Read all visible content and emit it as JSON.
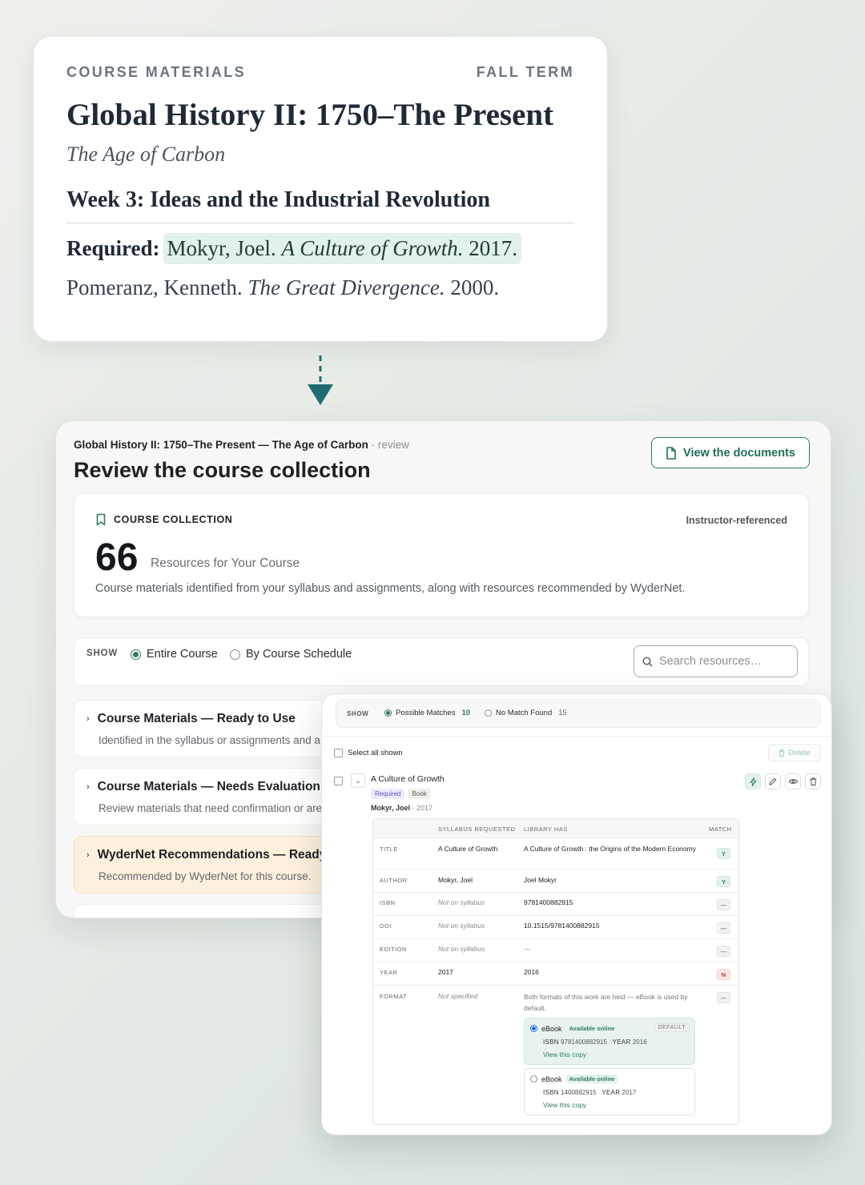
{
  "syllabus": {
    "kicker_left": "COURSE MATERIALS",
    "kicker_right": "FALL TERM",
    "title": "Global History II: 1750–The Present",
    "subtitle": "The Age of Carbon",
    "week": "Week 3: Ideas and the Industrial Revolution",
    "required_label": "Required:",
    "required_author": "Mokyr, Joel.",
    "required_work": "A Culture of Growth.",
    "required_year": "2017.",
    "second_author": "Pomeranz, Kenneth.",
    "second_work": "The Great Divergence.",
    "second_year": "2000."
  },
  "review": {
    "breadcrumb": "Global History II: 1750–The Present — The Age of Carbon",
    "breadcrumb_suffix": " · review",
    "title": "Review the course collection",
    "view_docs_label": "View the documents",
    "collection": {
      "label": "COURSE COLLECTION",
      "right_label": "Instructor-referenced",
      "count": "66",
      "count_label": "Resources for Your Course",
      "description": "Course materials identified from your syllabus and assignments, along with resources recommended by WyderNet."
    },
    "show": {
      "label": "SHOW",
      "option1": "Entire Course",
      "option2": "By Course Schedule",
      "search_placeholder": "Search resources…"
    },
    "sections": [
      {
        "title": "Course Materials — Ready to Use",
        "desc": "Identified in the syllabus or assignments and a"
      },
      {
        "title": "Course Materials — Needs Evaluation",
        "desc": "Review materials that need confirmation or are"
      },
      {
        "title": "WyderNet Recommendations — Ready",
        "desc": "Recommended by WyderNet for this course."
      }
    ]
  },
  "matches": {
    "show_label": "SHOW",
    "opt_possible": "Possible Matches",
    "opt_possible_count": "10",
    "opt_nomatch": "No Match Found",
    "opt_nomatch_count": "15",
    "select_all": "Select all shown",
    "delete_label": "Delete",
    "item": {
      "title": "A Culture of Growth",
      "tag_required": "Required",
      "tag_book": "Book",
      "author": "Mokyr, Joel",
      "year": " · 2017"
    },
    "table": {
      "headers": [
        "",
        "SYLLABUS REQUESTED",
        "LIBRARY HAS",
        "MATCH"
      ],
      "rows": [
        {
          "key": "TITLE",
          "syllabus": "A Culture of Growth",
          "library": "A Culture of Growth : the Origins of the Modern Economy",
          "match": "Y"
        },
        {
          "key": "AUTHOR",
          "syllabus": "Mokyr, Joel",
          "library": "Joel Mokyr",
          "match": "Y"
        },
        {
          "key": "ISBN",
          "syllabus": "Not on syllabus",
          "library": "9781400882915",
          "match": "—"
        },
        {
          "key": "DOI",
          "syllabus": "Not on syllabus",
          "library": "10.1515/9781400882915",
          "match": "—"
        },
        {
          "key": "EDITION",
          "syllabus": "Not on syllabus",
          "library": "—",
          "match": "—"
        },
        {
          "key": "YEAR",
          "syllabus": "2017",
          "library": "2016",
          "match": "N"
        }
      ],
      "format": {
        "key": "FORMAT",
        "syllabus": "Not specified",
        "note": "Both formats of this work are held — eBook is used by default.",
        "match": "—",
        "copies": [
          {
            "format": "eBook",
            "avail": "Available online",
            "default": "DEFAULT",
            "isbn_label": "ISBN",
            "isbn": "9781400882915",
            "year_label": "YEAR",
            "year": "2016",
            "link": "View this copy"
          },
          {
            "format": "eBook",
            "avail": "Available online",
            "isbn_label": "ISBN",
            "isbn": "1400882915",
            "year_label": "YEAR",
            "year": "2017",
            "link": "View this copy"
          }
        ]
      }
    }
  },
  "colors": {
    "accent": "#2f7a66",
    "arrow": "#1f6b70",
    "warm_section": "#fdf1dd"
  }
}
